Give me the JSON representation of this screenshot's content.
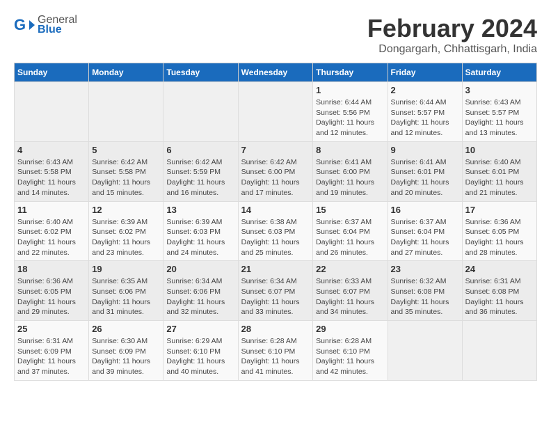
{
  "header": {
    "logo": {
      "general": "General",
      "blue": "Blue"
    },
    "title": "February 2024",
    "subtitle": "Dongargarh, Chhattisgarh, India"
  },
  "days_header": [
    "Sunday",
    "Monday",
    "Tuesday",
    "Wednesday",
    "Thursday",
    "Friday",
    "Saturday"
  ],
  "weeks": [
    [
      {
        "day": "",
        "info": ""
      },
      {
        "day": "",
        "info": ""
      },
      {
        "day": "",
        "info": ""
      },
      {
        "day": "",
        "info": ""
      },
      {
        "day": "1",
        "info": "Sunrise: 6:44 AM\nSunset: 5:56 PM\nDaylight: 11 hours\nand 12 minutes."
      },
      {
        "day": "2",
        "info": "Sunrise: 6:44 AM\nSunset: 5:57 PM\nDaylight: 11 hours\nand 12 minutes."
      },
      {
        "day": "3",
        "info": "Sunrise: 6:43 AM\nSunset: 5:57 PM\nDaylight: 11 hours\nand 13 minutes."
      }
    ],
    [
      {
        "day": "4",
        "info": "Sunrise: 6:43 AM\nSunset: 5:58 PM\nDaylight: 11 hours\nand 14 minutes."
      },
      {
        "day": "5",
        "info": "Sunrise: 6:42 AM\nSunset: 5:58 PM\nDaylight: 11 hours\nand 15 minutes."
      },
      {
        "day": "6",
        "info": "Sunrise: 6:42 AM\nSunset: 5:59 PM\nDaylight: 11 hours\nand 16 minutes."
      },
      {
        "day": "7",
        "info": "Sunrise: 6:42 AM\nSunset: 6:00 PM\nDaylight: 11 hours\nand 17 minutes."
      },
      {
        "day": "8",
        "info": "Sunrise: 6:41 AM\nSunset: 6:00 PM\nDaylight: 11 hours\nand 19 minutes."
      },
      {
        "day": "9",
        "info": "Sunrise: 6:41 AM\nSunset: 6:01 PM\nDaylight: 11 hours\nand 20 minutes."
      },
      {
        "day": "10",
        "info": "Sunrise: 6:40 AM\nSunset: 6:01 PM\nDaylight: 11 hours\nand 21 minutes."
      }
    ],
    [
      {
        "day": "11",
        "info": "Sunrise: 6:40 AM\nSunset: 6:02 PM\nDaylight: 11 hours\nand 22 minutes."
      },
      {
        "day": "12",
        "info": "Sunrise: 6:39 AM\nSunset: 6:02 PM\nDaylight: 11 hours\nand 23 minutes."
      },
      {
        "day": "13",
        "info": "Sunrise: 6:39 AM\nSunset: 6:03 PM\nDaylight: 11 hours\nand 24 minutes."
      },
      {
        "day": "14",
        "info": "Sunrise: 6:38 AM\nSunset: 6:03 PM\nDaylight: 11 hours\nand 25 minutes."
      },
      {
        "day": "15",
        "info": "Sunrise: 6:37 AM\nSunset: 6:04 PM\nDaylight: 11 hours\nand 26 minutes."
      },
      {
        "day": "16",
        "info": "Sunrise: 6:37 AM\nSunset: 6:04 PM\nDaylight: 11 hours\nand 27 minutes."
      },
      {
        "day": "17",
        "info": "Sunrise: 6:36 AM\nSunset: 6:05 PM\nDaylight: 11 hours\nand 28 minutes."
      }
    ],
    [
      {
        "day": "18",
        "info": "Sunrise: 6:36 AM\nSunset: 6:05 PM\nDaylight: 11 hours\nand 29 minutes."
      },
      {
        "day": "19",
        "info": "Sunrise: 6:35 AM\nSunset: 6:06 PM\nDaylight: 11 hours\nand 31 minutes."
      },
      {
        "day": "20",
        "info": "Sunrise: 6:34 AM\nSunset: 6:06 PM\nDaylight: 11 hours\nand 32 minutes."
      },
      {
        "day": "21",
        "info": "Sunrise: 6:34 AM\nSunset: 6:07 PM\nDaylight: 11 hours\nand 33 minutes."
      },
      {
        "day": "22",
        "info": "Sunrise: 6:33 AM\nSunset: 6:07 PM\nDaylight: 11 hours\nand 34 minutes."
      },
      {
        "day": "23",
        "info": "Sunrise: 6:32 AM\nSunset: 6:08 PM\nDaylight: 11 hours\nand 35 minutes."
      },
      {
        "day": "24",
        "info": "Sunrise: 6:31 AM\nSunset: 6:08 PM\nDaylight: 11 hours\nand 36 minutes."
      }
    ],
    [
      {
        "day": "25",
        "info": "Sunrise: 6:31 AM\nSunset: 6:09 PM\nDaylight: 11 hours\nand 37 minutes."
      },
      {
        "day": "26",
        "info": "Sunrise: 6:30 AM\nSunset: 6:09 PM\nDaylight: 11 hours\nand 39 minutes."
      },
      {
        "day": "27",
        "info": "Sunrise: 6:29 AM\nSunset: 6:10 PM\nDaylight: 11 hours\nand 40 minutes."
      },
      {
        "day": "28",
        "info": "Sunrise: 6:28 AM\nSunset: 6:10 PM\nDaylight: 11 hours\nand 41 minutes."
      },
      {
        "day": "29",
        "info": "Sunrise: 6:28 AM\nSunset: 6:10 PM\nDaylight: 11 hours\nand 42 minutes."
      },
      {
        "day": "",
        "info": ""
      },
      {
        "day": "",
        "info": ""
      }
    ]
  ]
}
